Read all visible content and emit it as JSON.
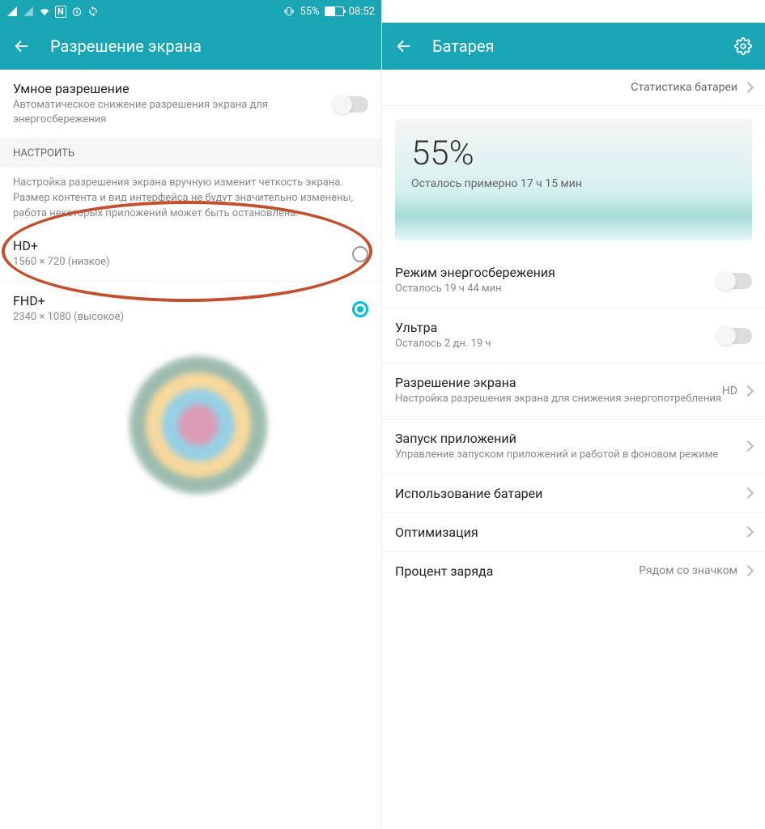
{
  "statusbar": {
    "battery_pct": "55%",
    "time": "08:52",
    "vibrate_icon": "vibrate",
    "icons": [
      "signal",
      "signal",
      "wifi",
      "nfc",
      "alarm",
      "sync"
    ]
  },
  "left": {
    "header_title": "Разрешение экрана",
    "smart": {
      "title": "Умное разрешение",
      "sub": "Автоматическое снижение разрешения экрана для энергосбережения"
    },
    "section_header": "НАСТРОИТЬ",
    "section_desc": "Настройка разрешения экрана вручную изменит четкость экрана. Размер контента и вид интерфейса не будут значительно изменены, работа некоторых приложений может быть остановлена.",
    "hd": {
      "title": "HD+",
      "sub": "1560 × 720 (низкое)"
    },
    "fhd": {
      "title": "FHD+",
      "sub": "2340 × 1080 (высокое)"
    }
  },
  "right": {
    "header_title": "Батарея",
    "stats_link": "Статистика батареи",
    "battery_pct": "55%",
    "remaining": "Осталось примерно 17 ч 15 мин",
    "rows": {
      "power_save": {
        "title": "Режим энергосбережения",
        "sub": "Осталось 19 ч 44 мин"
      },
      "ultra": {
        "title": "Ультра",
        "sub": "Осталось 2 дн. 19 ч"
      },
      "resolution": {
        "title": "Разрешение экрана",
        "sub": "Настройка разрешения экрана для снижения энергопотребления",
        "value": "HD"
      },
      "app_launch": {
        "title": "Запуск приложений",
        "sub": "Управление запуском приложений и работой в фоновом режиме"
      },
      "usage": {
        "title": "Использование батареи"
      },
      "optimize": {
        "title": "Оптимизация"
      },
      "percent": {
        "title": "Процент заряда",
        "value": "Рядом со значком"
      }
    }
  }
}
